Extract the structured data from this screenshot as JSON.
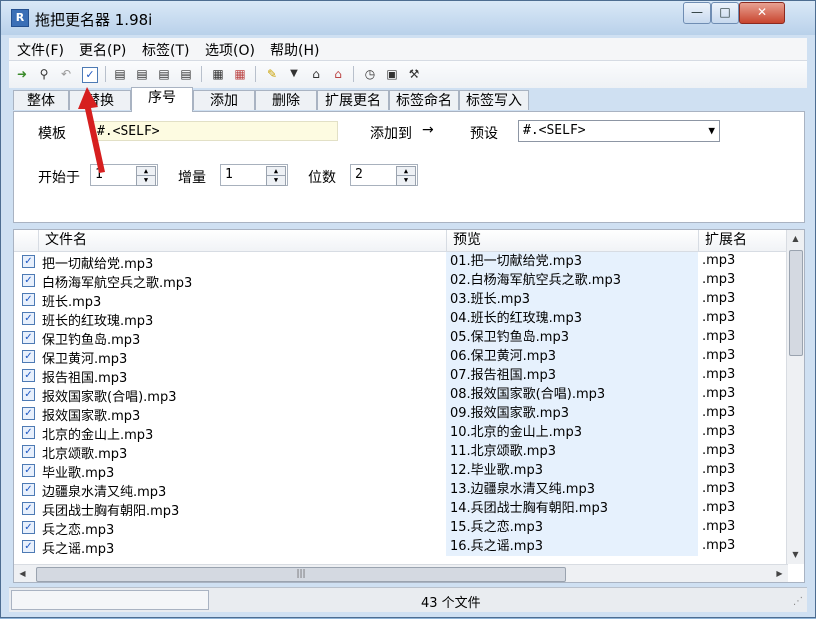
{
  "window": {
    "title": "拖把更名器 1.98i",
    "minimize_glyph": "—",
    "maximize_glyph": "□",
    "close_glyph": "✕",
    "app_icon_letter": "R"
  },
  "menu": [
    "文件(F)",
    "更名(P)",
    "标签(T)",
    "选项(O)",
    "帮助(H)"
  ],
  "toolbar_icons": [
    "open-folder-icon",
    "search-icon",
    "undo-icon",
    "check-icon",
    "id3-icon-1",
    "id3-icon-2",
    "id3-icon-3",
    "id3-icon-4",
    "page-icon",
    "page-edit-icon",
    "pencil-icon",
    "dropdown-arrow-icon",
    "tag-icon",
    "tag-clear-icon",
    "clock-icon",
    "window-icon",
    "tools-icon"
  ],
  "tabs": [
    "整体",
    "替换",
    "序号",
    "添加",
    "删除",
    "扩展更名",
    "标签命名",
    "标签写入"
  ],
  "active_tab": "序号",
  "panel": {
    "template_label": "模板",
    "template_value": "#.<SELF>",
    "add_to_label": "添加到",
    "add_to_arrow": "→",
    "preset_label": "预设",
    "preset_value": "#.<SELF>",
    "start_label": "开始于",
    "start_value": "1",
    "step_label": "增量",
    "step_value": "1",
    "digits_label": "位数",
    "digits_value": "2"
  },
  "columns": [
    "文件名",
    "预览",
    "扩展名"
  ],
  "rows": [
    {
      "name": "把一切献给党.mp3",
      "preview": "01.把一切献给党.mp3",
      "ext": ".mp3"
    },
    {
      "name": "白杨海军航空兵之歌.mp3",
      "preview": "02.白杨海军航空兵之歌.mp3",
      "ext": ".mp3"
    },
    {
      "name": "班长.mp3",
      "preview": "03.班长.mp3",
      "ext": ".mp3"
    },
    {
      "name": "班长的红玫瑰.mp3",
      "preview": "04.班长的红玫瑰.mp3",
      "ext": ".mp3"
    },
    {
      "name": "保卫钓鱼岛.mp3",
      "preview": "05.保卫钓鱼岛.mp3",
      "ext": ".mp3"
    },
    {
      "name": "保卫黄河.mp3",
      "preview": "06.保卫黄河.mp3",
      "ext": ".mp3"
    },
    {
      "name": "报告祖国.mp3",
      "preview": "07.报告祖国.mp3",
      "ext": ".mp3"
    },
    {
      "name": "报效国家歌(合唱).mp3",
      "preview": "08.报效国家歌(合唱).mp3",
      "ext": ".mp3"
    },
    {
      "name": "报效国家歌.mp3",
      "preview": "09.报效国家歌.mp3",
      "ext": ".mp3"
    },
    {
      "name": "北京的金山上.mp3",
      "preview": "10.北京的金山上.mp3",
      "ext": ".mp3"
    },
    {
      "name": "北京颂歌.mp3",
      "preview": "11.北京颂歌.mp3",
      "ext": ".mp3"
    },
    {
      "name": "毕业歌.mp3",
      "preview": "12.毕业歌.mp3",
      "ext": ".mp3"
    },
    {
      "name": "边疆泉水清又纯.mp3",
      "preview": "13.边疆泉水清又纯.mp3",
      "ext": ".mp3"
    },
    {
      "name": "兵团战士胸有朝阳.mp3",
      "preview": "14.兵团战士胸有朝阳.mp3",
      "ext": ".mp3"
    },
    {
      "name": "兵之恋.mp3",
      "preview": "15.兵之恋.mp3",
      "ext": ".mp3"
    },
    {
      "name": "兵之谣.mp3",
      "preview": "16.兵之谣.mp3",
      "ext": ".mp3"
    }
  ],
  "status": {
    "count_text": "43 个文件"
  },
  "colors": {
    "panel_bg": "#cfe0f2",
    "preview_bg": "#e6f1fd",
    "template_bg": "#fdfbe1",
    "annotation_arrow": "#d61f1f"
  }
}
